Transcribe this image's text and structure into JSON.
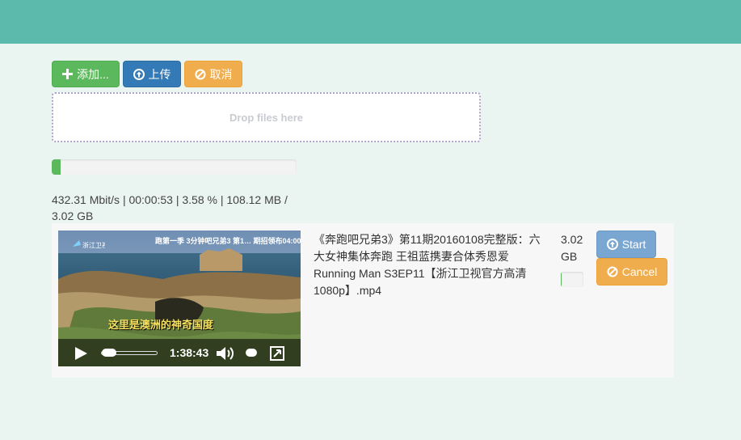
{
  "toolbar": {
    "add_label": "添加...",
    "upload_label": "上传",
    "cancel_label": "取消"
  },
  "dropzone": {
    "text": "Drop files here"
  },
  "global_progress": {
    "percent": 3.58
  },
  "stats": {
    "text": "432.31 Mbit/s | 00:00:53 | 3.58 % | 108.12 MB / 3.02 GB"
  },
  "file": {
    "name": "《奔跑吧兄弟3》第11期20160108完整版：六大女神集体奔跑 王祖蓝携妻合体秀恩爱 Running Man S3EP11【浙江卫视官方高清1080p】.mp4",
    "size": "3.02 GB",
    "progress_percent": 3.58,
    "start_label": "Start",
    "cancel_label": "Cancel"
  },
  "video": {
    "time": "1:38:43",
    "logo_text": "浙江卫视",
    "top_caption": "跑第一季 3分钟吧兄弟3 第1… 期招领布04:00",
    "subtitle": "这里是澳洲的神奇国度"
  },
  "colors": {
    "topbar": "#5bbaab",
    "success": "#5cb85c",
    "primary": "#337ab7",
    "warning": "#f0ad4e",
    "background": "#eaf4f1"
  }
}
